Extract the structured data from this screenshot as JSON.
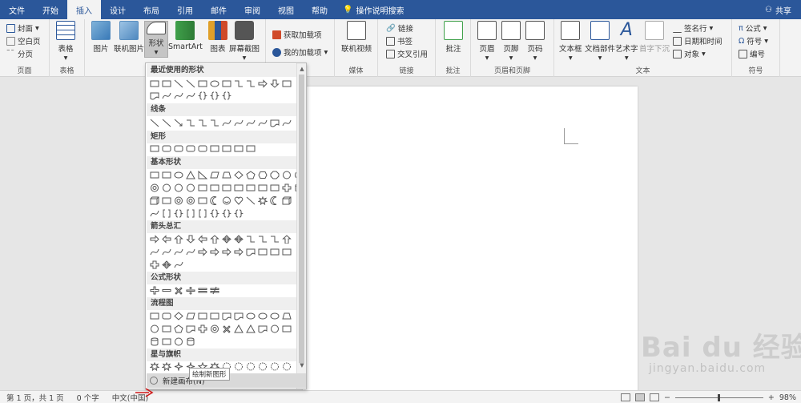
{
  "tabs": [
    "文件",
    "开始",
    "插入",
    "设计",
    "布局",
    "引用",
    "邮件",
    "审阅",
    "视图",
    "帮助"
  ],
  "active_tab": "插入",
  "tell_me": "操作说明搜索",
  "share": "共享",
  "ribbon": {
    "pages": {
      "cover": "封面",
      "blank": "空白页",
      "break": "分页",
      "label": "页面"
    },
    "tables": {
      "table": "表格",
      "label": "表格"
    },
    "illustrations": {
      "picture": "图片",
      "online_picture": "联机图片",
      "shapes": "形状",
      "smartart": "SmartArt",
      "chart": "图表",
      "screenshot": "屏幕截图"
    },
    "addins": {
      "get": "获取加载项",
      "my": "我的加载项"
    },
    "media": {
      "online_video": "联机视频",
      "label": "媒体"
    },
    "links": {
      "link": "链接",
      "bookmark": "书签",
      "crossref": "交叉引用",
      "label": "链接"
    },
    "comments": {
      "comment": "批注",
      "label": "批注"
    },
    "header_footer": {
      "header": "页眉",
      "footer": "页脚",
      "page_number": "页码",
      "label": "页眉和页脚"
    },
    "text": {
      "textbox": "文本框",
      "quickparts": "文档部件",
      "wordart": "艺术字",
      "dropcap": "首字下沉",
      "signature": "签名行",
      "datetime": "日期和时间",
      "object": "对象",
      "label": "文本"
    },
    "symbols": {
      "equation": "公式",
      "symbol": "符号",
      "number": "编号",
      "label": "符号"
    }
  },
  "shapes_menu": {
    "categories": [
      "最近使用的形状",
      "线条",
      "矩形",
      "基本形状",
      "箭头总汇",
      "公式形状",
      "流程图",
      "星与旗帜"
    ],
    "new_canvas": "新建画布(N)",
    "tooltip": "绘制新图形"
  },
  "status": {
    "page": "第 1 页，共 1 页",
    "words": "0 个字",
    "language": "中文(中国)",
    "zoom": "98%"
  },
  "watermark": {
    "brand": "Bai du 经验",
    "url": "jingyan.baidu.com"
  },
  "colors": {
    "accent": "#2b579a",
    "ribbon": "#f3f3f3"
  }
}
